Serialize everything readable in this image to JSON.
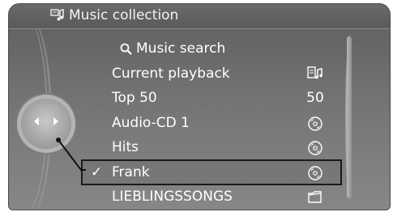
{
  "header": {
    "title": "Music collection",
    "icon": "music-collection-icon"
  },
  "menu": {
    "items": [
      {
        "label": "Music search",
        "icon": "search-icon",
        "right": ""
      },
      {
        "label": "Current playback",
        "icon": "",
        "right_icon": "current-playback-icon"
      },
      {
        "label": "Top 50",
        "icon": "",
        "right": "50"
      },
      {
        "label": "Audio-CD 1",
        "icon": "",
        "right_icon": "cd-icon"
      },
      {
        "label": "Hits",
        "icon": "",
        "right_icon": "cd-icon"
      },
      {
        "label": "Frank",
        "icon": "",
        "right_icon": "cd-icon",
        "selected": true,
        "check": "✓"
      },
      {
        "label": "LIEBLINGSSONGS",
        "icon": "",
        "right_icon": "folder-icon"
      }
    ]
  },
  "colors": {
    "panel_bg": "#6e6e6e",
    "text": "#ffffff",
    "highlight_border": "#1a1a1a"
  }
}
